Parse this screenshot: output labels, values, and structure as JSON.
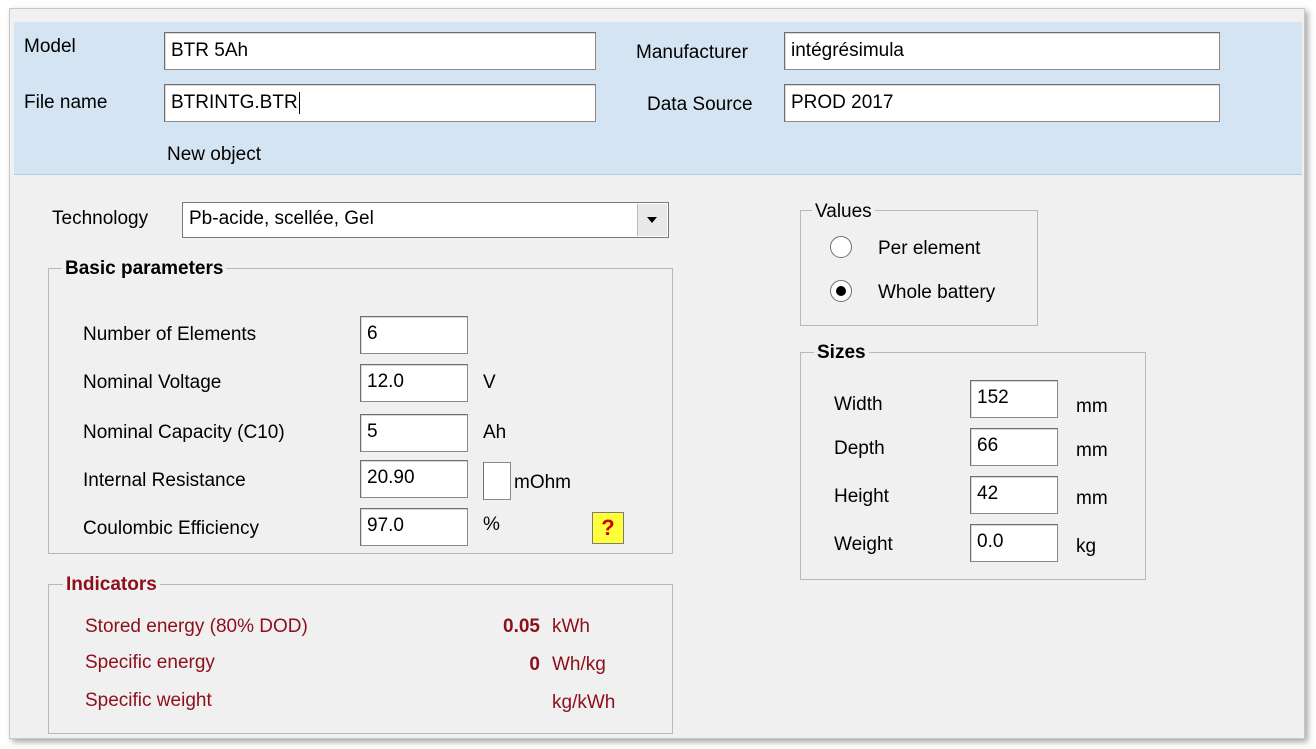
{
  "header": {
    "model_label": "Model",
    "model_value": "BTR 5Ah",
    "file_name_label": "File name",
    "file_name_value": "BTRINTG.BTR",
    "manufacturer_label": "Manufacturer",
    "manufacturer_value": "intégrésimula",
    "data_source_label": "Data Source",
    "data_source_value": "PROD 2017",
    "status_text": "New object"
  },
  "technology": {
    "label": "Technology",
    "selected": "Pb-acide, scellée, Gel"
  },
  "basic_parameters": {
    "title": "Basic parameters",
    "rows": [
      {
        "label": "Number of Elements",
        "value": "6",
        "unit": ""
      },
      {
        "label": "Nominal Voltage",
        "value": "12.0",
        "unit": "V"
      },
      {
        "label": "Nominal Capacity (C10)",
        "value": "5",
        "unit": "Ah"
      },
      {
        "label": "Internal Resistance",
        "value": "20.90",
        "unit": "mOhm"
      },
      {
        "label": "Coulombic Efficiency",
        "value": "97.0",
        "unit": "%"
      }
    ],
    "help_label": "?"
  },
  "indicators": {
    "title": "Indicators",
    "rows": [
      {
        "label": "Stored energy  (80% DOD)",
        "value": "0.05",
        "unit": "kWh"
      },
      {
        "label": "Specific energy",
        "value": "0",
        "unit": "Wh/kg"
      },
      {
        "label": "Specific weight",
        "value": "",
        "unit": "kg/kWh"
      }
    ]
  },
  "values": {
    "title": "Values",
    "options": [
      "Per element",
      "Whole battery"
    ],
    "selected": "Whole battery"
  },
  "sizes": {
    "title": "Sizes",
    "rows": [
      {
        "label": "Width",
        "value": "152",
        "unit": "mm"
      },
      {
        "label": "Depth",
        "value": "66",
        "unit": "mm"
      },
      {
        "label": "Height",
        "value": "42",
        "unit": "mm"
      },
      {
        "label": "Weight",
        "value": "0.0",
        "unit": "kg"
      }
    ]
  },
  "icons": {
    "combo_arrow": "chevron-down-icon",
    "help": "help-icon",
    "radio": "radio-button"
  }
}
